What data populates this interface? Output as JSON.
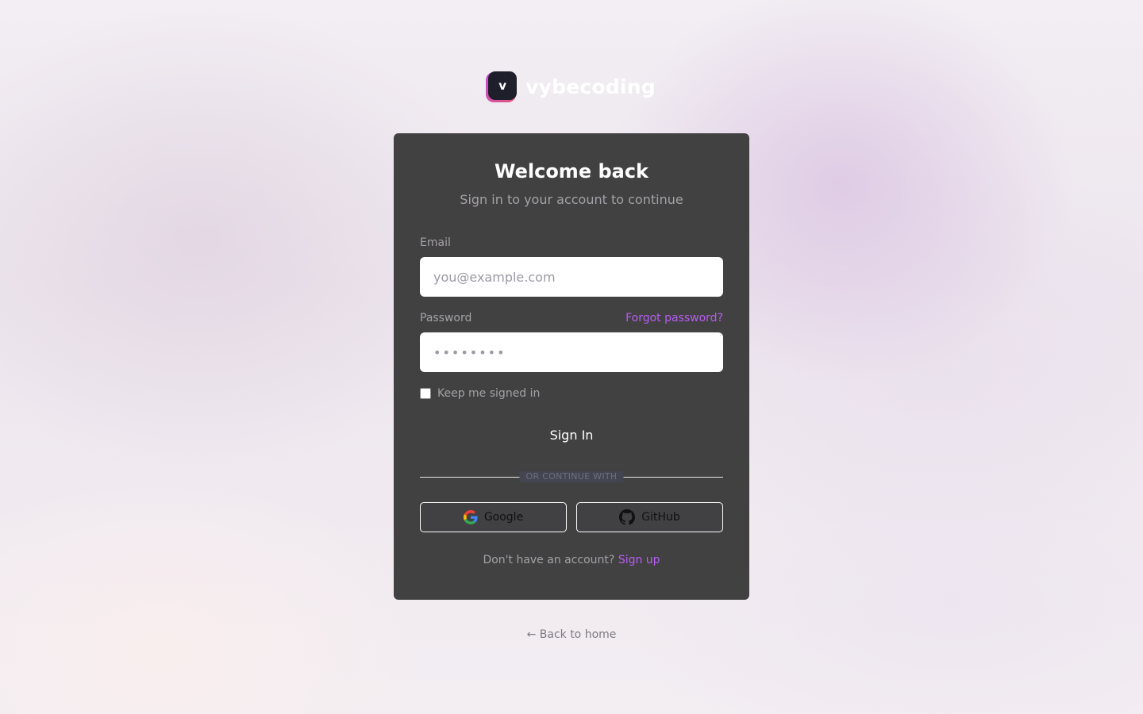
{
  "brand": {
    "logo_letter": "v",
    "name": "vybecoding",
    "accent_colors": [
      "#c14cd9",
      "#e3567a"
    ]
  },
  "card": {
    "title": "Welcome back",
    "subtitle": "Sign in to your account to continue",
    "email": {
      "label": "Email",
      "placeholder": "you@example.com",
      "value": ""
    },
    "password": {
      "label": "Password",
      "masked_value": "••••••••",
      "forgot_link": "Forgot password?"
    },
    "remember": {
      "label": "Keep me signed in",
      "checked": false
    },
    "signin_button": "Sign In",
    "divider_text": "OR CONTINUE WITH",
    "social": {
      "google": {
        "label": "Google",
        "icon": "google-icon"
      },
      "github": {
        "label": "GitHub",
        "icon": "github-icon"
      }
    },
    "signup_prompt": "Don't have an account?",
    "signup_link": "Sign up"
  },
  "back_link": "← Back to home",
  "colors": {
    "card_bg": "#424142",
    "link": "#b65ef2",
    "muted_text": "#a3a1a5"
  }
}
